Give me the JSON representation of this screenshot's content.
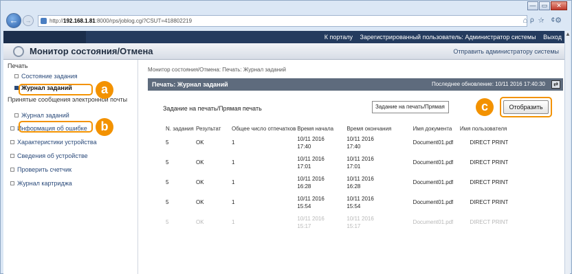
{
  "browser": {
    "url_prefix": "http://",
    "url_host": "192.168.1.81",
    "url_rest": ":8000/rps/joblog.cgi?CSUT=418802219",
    "address_tools": "ρ - ¢",
    "tab_tools": "⌂ ☆ ⚙",
    "window_buttons": [
      "—",
      "▭",
      "✕"
    ],
    "back_glyph": "←",
    "forward_glyph": "→"
  },
  "topbar": {
    "links": [
      "К порталу",
      "Зарегистрированный пользователь: Администратор системы",
      "Выход"
    ]
  },
  "header": {
    "title": "Монитор состояния/Отмена",
    "mail_admin": "Отправить администратору системы"
  },
  "sidebar": {
    "section_print": "Печать",
    "item_job_status": "Состояние задания",
    "item_job_log": "Журнал заданий",
    "section_email": "Принятые сообщения электронной почты",
    "item_email_log": "Журнал заданий",
    "item_error_info": "Информация об ошибке",
    "item_device_features": "Характеристики устройства",
    "item_device_info": "Сведения об устройстве",
    "item_check_counter": "Проверить счетчик",
    "item_cartridge_log": "Журнал картриджа"
  },
  "main": {
    "breadcrumb": "Монитор состояния/Отмена: Печать: Журнал заданий",
    "panel_title": "Печать: Журнал заданий",
    "last_update": "Последнее обновление: 10/11 2016 17:40:30",
    "refresh_glyph": "⇄",
    "filter_label": "Задание на печать/Прямая печать",
    "filter_value": "Задание на печать/Прямая",
    "show_button": "Отобразить"
  },
  "table": {
    "columns": [
      "N. задания",
      "Результат",
      "Общее число отпечатков",
      "Время начала",
      "Время окончания",
      "Имя документа",
      "Имя пользователя"
    ],
    "rows": [
      {
        "job": "5",
        "result": "OK",
        "total": "1",
        "start_date": "10/11 2016",
        "start_time": "17:40",
        "end_date": "10/11 2016",
        "end_time": "17:40",
        "doc": "Document01.pdf",
        "user": "DIRECT PRINT"
      },
      {
        "job": "5",
        "result": "OK",
        "total": "1",
        "start_date": "10/11 2016",
        "start_time": "17:01",
        "end_date": "10/11 2016",
        "end_time": "17:01",
        "doc": "Document01.pdf",
        "user": "DIRECT PRINT"
      },
      {
        "job": "5",
        "result": "OK",
        "total": "1",
        "start_date": "10/11 2016",
        "start_time": "16:28",
        "end_date": "10/11 2016",
        "end_time": "16:28",
        "doc": "Document01.pdf",
        "user": "DIRECT PRINT"
      },
      {
        "job": "5",
        "result": "OK",
        "total": "1",
        "start_date": "10/11 2016",
        "start_time": "15:54",
        "end_date": "10/11 2016",
        "end_time": "15:54",
        "doc": "Document01.pdf",
        "user": "DIRECT PRINT"
      },
      {
        "job": "5",
        "result": "OK",
        "total": "1",
        "start_date": "10/11 2016",
        "start_time": "15:17",
        "end_date": "10/11 2016",
        "end_time": "15:17",
        "doc": "Document01.pdf",
        "user": "DIRECT PRINT"
      }
    ]
  },
  "callouts": {
    "a": "a",
    "b": "b",
    "c": "c",
    "color": "#f39200"
  }
}
